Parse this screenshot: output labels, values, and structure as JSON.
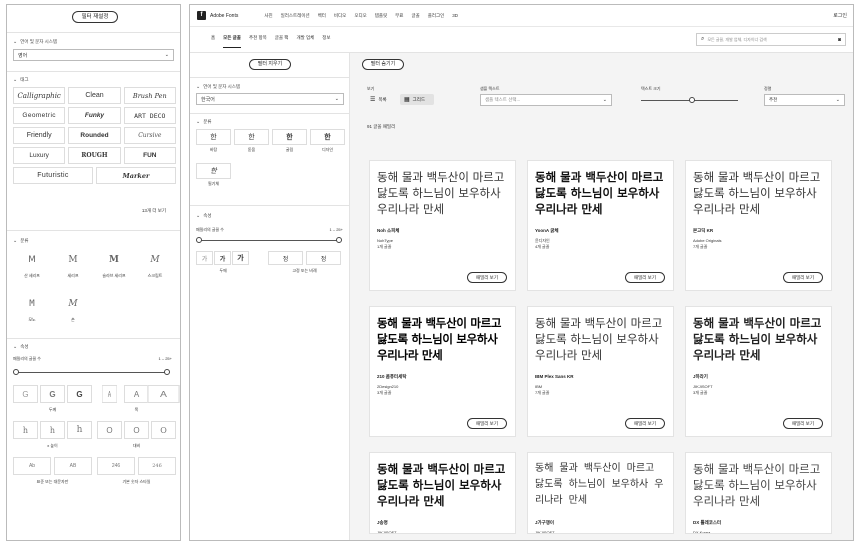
{
  "left_panel": {
    "filter_reset": "필터 재설정",
    "language_section": "언어 및 문자 시스템",
    "language_value": "영어",
    "tag_section": "태그",
    "tags": [
      "Calligraphic",
      "Clean",
      "Brush Pen",
      "Geometric",
      "Funky",
      "ART DECO",
      "Friendly",
      "Rounded",
      "Cursive",
      "Luxury",
      "ROUGH",
      "FUN",
      "Futuristic",
      "Marker"
    ],
    "more_tags": "13개 더 보기",
    "class_section": "분류",
    "class_items": [
      {
        "glyph": "M",
        "label": "산 세리프"
      },
      {
        "glyph": "M",
        "label": "세리프"
      },
      {
        "glyph": "M",
        "label": "슬라브 세리프"
      },
      {
        "glyph": "M",
        "label": "스크립트"
      },
      {
        "glyph": "M",
        "label": "모노"
      },
      {
        "glyph": "M",
        "label": "손"
      }
    ],
    "attr_section": "속성",
    "family_count_label": "패밀리의 글꼴 수",
    "family_count_range": "1 – 25+",
    "weight_glyphs": [
      "G",
      "G",
      "G"
    ],
    "weight_label": "두께",
    "width_glyphs": [
      "A",
      "A",
      "A"
    ],
    "width_label": "폭",
    "xheight_glyphs": [
      "h",
      "h",
      "h"
    ],
    "xheight_label": "x 높이",
    "contrast_glyphs": [
      "O",
      "O",
      "O"
    ],
    "contrast_label": "대비",
    "case_glyphs": [
      "Ab",
      "AB"
    ],
    "case_label": "표준 또는 대문자만",
    "numeral_glyphs": [
      "246",
      "246"
    ],
    "numeral_label": "기본 숫자 스타일"
  },
  "top_bar": {
    "logo_mark": "f",
    "logo_text": "Adobe Fonts",
    "nav": [
      "사진",
      "일러스트레이션",
      "벡터",
      "비디오",
      "오디오",
      "템플릿",
      "3D"
    ],
    "nav_free": "무료",
    "nav_fonts": "글꼴",
    "nav_plugin": "플러그인",
    "login": "로그인"
  },
  "sub_nav": {
    "tabs": [
      "홈",
      "모든 글꼴",
      "추천 항목",
      "글꼴 팩",
      "개발 업체",
      "정보"
    ],
    "active_index": 1,
    "search_placeholder": "모든 글꼴, 개발 업체, 디자이너 검색"
  },
  "right_sidebar": {
    "filter_reset": "필터 지우기",
    "language_section": "언어 및 문자 시스템",
    "language_value": "한국어",
    "class_section": "분류",
    "class_items": [
      {
        "glyph": "한",
        "label": "바탕"
      },
      {
        "glyph": "한",
        "label": "돋움"
      },
      {
        "glyph": "한",
        "label": "굴림"
      },
      {
        "glyph": "한",
        "label": "디자인"
      },
      {
        "glyph": "한",
        "label": "필기체"
      }
    ],
    "attr_section": "속성",
    "family_count_label": "패밀리의 글꼴 수",
    "family_count_range": "1 – 25+",
    "weight_glyphs": [
      "가",
      "가",
      "가"
    ],
    "weight_label": "두께",
    "width_glyphs": [
      "정",
      "정"
    ],
    "width_label": "고정 또는 비례"
  },
  "toolbar": {
    "hide_filters": "필터 숨기기",
    "view_label": "보기",
    "view_list": "목록",
    "view_grid": "그리드",
    "sample_text_label": "샘플 텍스트",
    "sample_text_placeholder": "샘플 텍스트 선택...",
    "text_size_label": "텍스트 크기",
    "sort_label": "정렬",
    "sort_value": "추천",
    "result_count": "91 글꼴 패밀리"
  },
  "sample_text": "동해 물과 백두산이 마르고 닳도록 하느님이 보우하사 우리나라 만세",
  "family_button": "패밀리 보기",
  "cards": [
    {
      "name": "Noh 소피체",
      "foundry": "NohType",
      "count": "1개 글꼴",
      "style": "sans-light"
    },
    {
      "name": "YoonA 굵체",
      "foundry": "윤디자인",
      "count": "4개 글꼴",
      "style": "bold"
    },
    {
      "name": "본고딕 KR",
      "foundry": "Adobe Originals",
      "count": "7개 글꼴",
      "style": "sans-light"
    },
    {
      "name": "210 콤퓨터세탁",
      "foundry": "2Design210",
      "count": "3개 글꼴",
      "style": "heavy"
    },
    {
      "name": "IBM Plex Sans KR",
      "foundry": "IBM",
      "count": "7개 글꼴",
      "style": "sans-light"
    },
    {
      "name": "J하라기",
      "foundry": "JIKJISOFT",
      "count": "3개 글꼴",
      "style": "round-bold"
    },
    {
      "name": "J송명",
      "foundry": "JIKJISOFT",
      "count": "1개 글꼴",
      "style": "serif-bold"
    },
    {
      "name": "J가구쟁이",
      "foundry": "JIKJISOFT",
      "count": "1개 글꼴",
      "style": "hand"
    },
    {
      "name": "DX 틀레코스터",
      "foundry": "DX Korea",
      "count": "1개 글꼴",
      "style": "round"
    }
  ]
}
